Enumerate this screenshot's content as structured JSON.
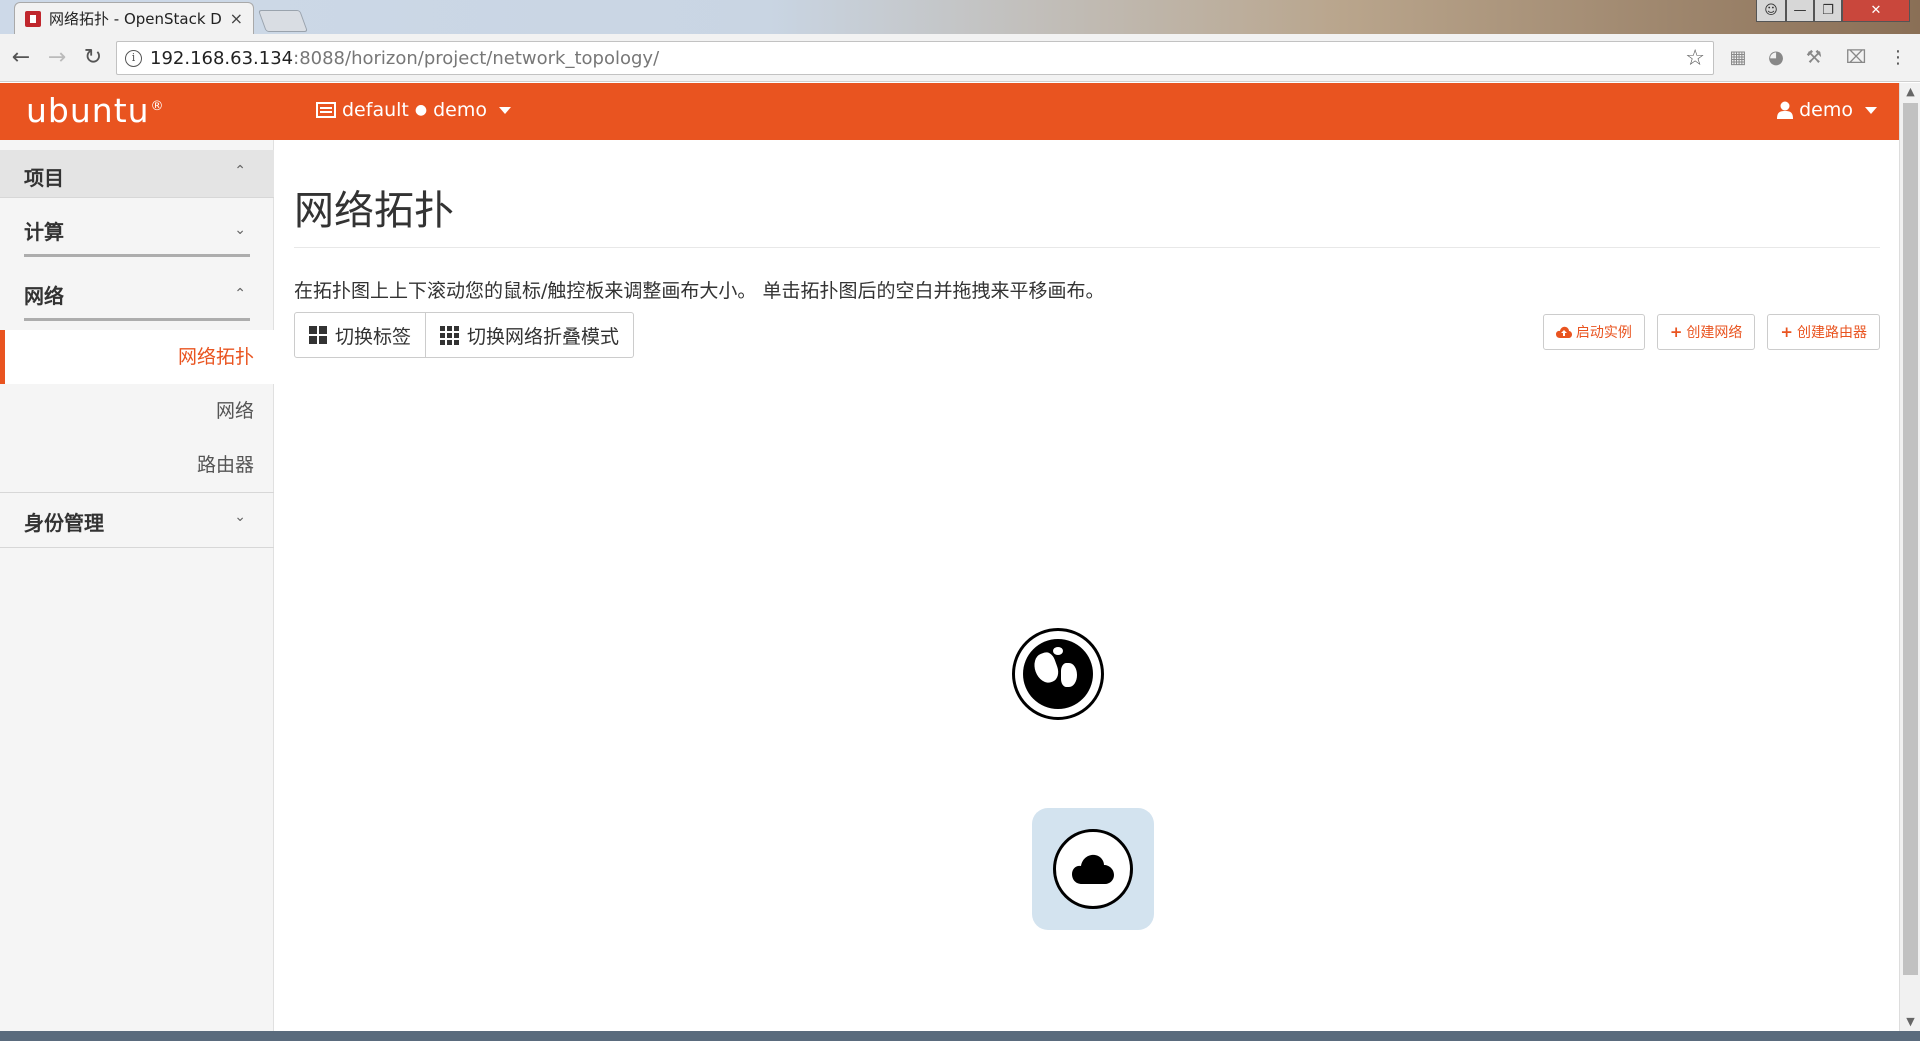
{
  "browser": {
    "tab_title": "网络拓扑 - OpenStack D",
    "tab_close": "×",
    "url_host": "192.168.63.134",
    "url_path": ":8088/horizon/project/network_topology/"
  },
  "header": {
    "logo": "ubuntu",
    "logo_mark": "®",
    "project_domain": "default",
    "project_sep": "●",
    "project_name": "demo",
    "user_name": "demo"
  },
  "sidebar": {
    "project": "项目",
    "compute": "计算",
    "network": "网络",
    "items": [
      {
        "label": "网络拓扑",
        "active": true
      },
      {
        "label": "网络",
        "active": false
      },
      {
        "label": "路由器",
        "active": false
      }
    ],
    "identity": "身份管理"
  },
  "main": {
    "title": "网络拓扑",
    "help_text": "在拓扑图上上下滚动您的鼠标/触控板来调整画布大小。 单击拓扑图后的空白并拖拽来平移画布。",
    "toggle_labels": "切换标签",
    "toggle_collapse": "切换网络折叠模式",
    "launch_instance": "启动实例",
    "create_network": "创建网络",
    "create_router": "创建路由器"
  },
  "colors": {
    "brand": "#e95420",
    "node_highlight": "#d3e3ef"
  },
  "icons": {
    "external_network": "globe-icon",
    "router": "cloud-icon"
  }
}
